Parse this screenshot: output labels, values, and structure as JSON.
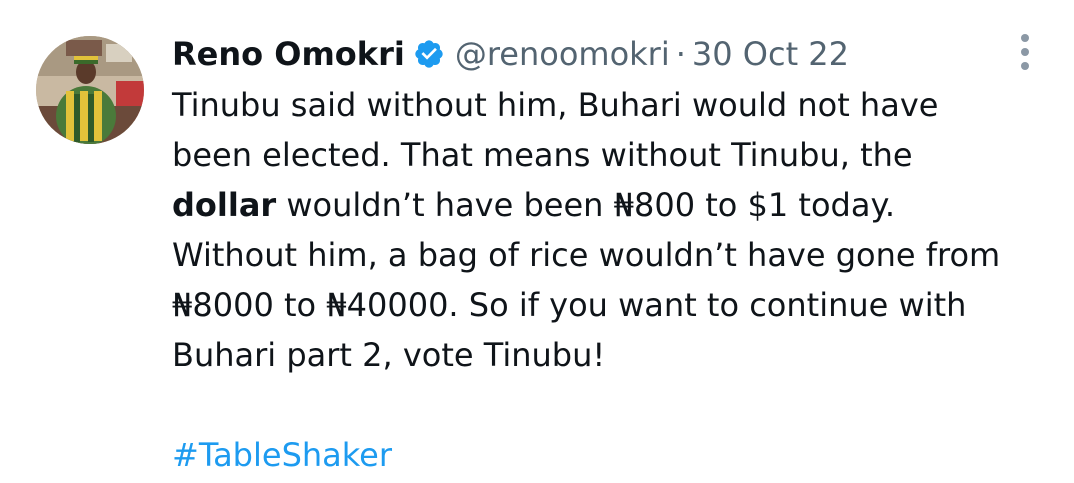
{
  "tweet": {
    "author_name": "Reno Omokri",
    "handle": "@renoomokri",
    "separator": "·",
    "date": "30 Oct 22",
    "verified_icon": "verified-badge-icon",
    "more_icon": "more-vertical-icon",
    "text": {
      "line1": "Tinubu said without him, Buhari would not have",
      "line2": "been elected. That means without Tinubu, the",
      "line3_bold": "dollar",
      "line3_rest": " wouldn’t have been ₦800 to $1 today.",
      "line4": "Without him, a bag of rice wouldn’t have gone from",
      "line5": "₦8000 to ₦40000. So if you want to continue with",
      "line6": "Buhari part 2, vote Tinubu!"
    },
    "hashtag": "#TableShaker",
    "colors": {
      "text": "#0f1419",
      "secondary": "#536471",
      "link": "#1d9bf0",
      "verified": "#1d9bf0"
    }
  }
}
